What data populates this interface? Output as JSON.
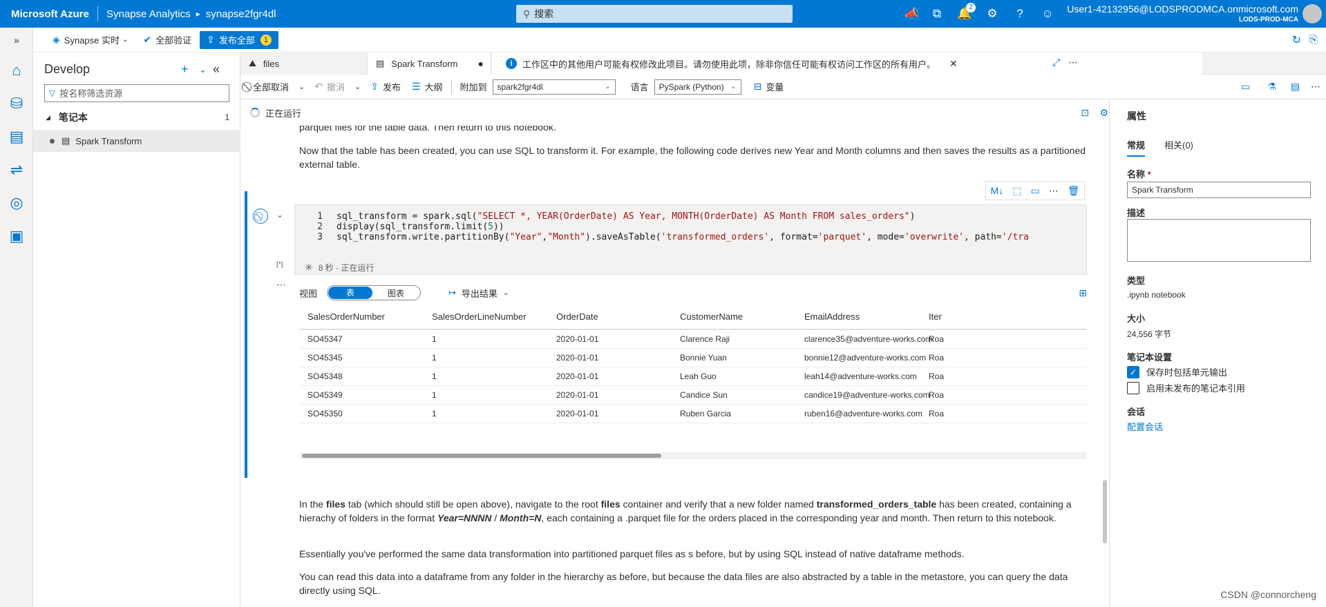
{
  "topbar": {
    "brand": "Microsoft Azure",
    "crumb1": "Synapse Analytics",
    "crumb2": "synapse2fgr4dl",
    "search_placeholder": "搜索",
    "notifications_count": "2",
    "user_name": "User1-42132956@LODSPRODMCA.onmicrosoft.com",
    "user_tenant": "LODS-PROD-MCA"
  },
  "commandbar": {
    "live_mode": "Synapse 实时",
    "validate_all": "全部验证",
    "publish_all": "发布全部",
    "publish_badge": "1"
  },
  "develop": {
    "title": "Develop",
    "filter_placeholder": "按名称筛选资源",
    "group_label": "笔记本",
    "group_count": "1",
    "item_label": "Spark Transform"
  },
  "tabs": {
    "files": "files",
    "spark": "Spark Transform",
    "modified_marker": "●",
    "warning": "工作区中的其他用户可能有权修改此项目。请勿使用此项，除非你信任可能有权访问工作区的所有用户。"
  },
  "nbtoolbar": {
    "cancel_all": "全部取消",
    "undo": "撤消",
    "publish": "发布",
    "outline": "大纲",
    "attach_label": "附加到",
    "attach_value": "spark2fgr4dl",
    "language_label": "语言",
    "language_value": "PySpark (Python)",
    "variables": "变量"
  },
  "status": {
    "running": "正在运行"
  },
  "content": {
    "para_top": "parquet files for the table data. Then return to this notebook.",
    "para_1": "Now that the table has been created, you can use SQL to transform it. For example, the following code derives new Year and Month columns and then saves the results as a partitioned external table.",
    "exec_count": "[*]",
    "exec_status": "8 秒 - 正在运行",
    "code": {
      "l1": "1",
      "l2": "2",
      "l3": "3",
      "c1_a": "sql_transform = spark.sql(",
      "c1_b": "\"SELECT *, YEAR(OrderDate) AS Year, MONTH(OrderDate) AS Month FROM sales_orders\"",
      "c1_c": ")",
      "c2_a": "display(sql_transform.limit(",
      "c2_b": "5",
      "c2_c": "))",
      "c3_a": "sql_transform.write.partitionBy(",
      "c3_b": "\"Year\"",
      "c3_c": ",",
      "c3_d": "\"Month\"",
      "c3_e": ").saveAsTable(",
      "c3_f": "'transformed_orders'",
      "c3_g": ", format=",
      "c3_h": "'parquet'",
      "c3_i": ", mode=",
      "c3_j": "'overwrite'",
      "c3_k": ", path=",
      "c3_l": "'/tra"
    },
    "view_label": "视图",
    "toggle_table": "表",
    "toggle_chart": "图表",
    "export_label": "导出结果",
    "table": {
      "headers": [
        "SalesOrderNumber",
        "SalesOrderLineNumber",
        "OrderDate",
        "CustomerName",
        "EmailAddress",
        "Iter"
      ],
      "rows": [
        [
          "SO45347",
          "1",
          "2020-01-01",
          "Clarence Raji",
          "clarence35@adventure-works.com",
          "Roa"
        ],
        [
          "SO45345",
          "1",
          "2020-01-01",
          "Bonnie Yuan",
          "bonnie12@adventure-works.com",
          "Roa"
        ],
        [
          "SO45348",
          "1",
          "2020-01-01",
          "Leah Guo",
          "leah14@adventure-works.com",
          "Roa"
        ],
        [
          "SO45349",
          "1",
          "2020-01-01",
          "Candice Sun",
          "candice19@adventure-works.com",
          "Roa"
        ],
        [
          "SO45350",
          "1",
          "2020-01-01",
          "Ruben Garcia",
          "ruben16@adventure-works.com",
          "Roa"
        ]
      ]
    },
    "para_2a": "In the ",
    "para_2b": "files",
    "para_2c": " tab (which should still be open above), navigate to the root ",
    "para_2d": "files",
    "para_2e": " container and verify that a new folder named ",
    "para_2f": "transformed_orders_table",
    "para_2g": " has been created, containing a hierachy of folders in the format ",
    "para_2h": "Year=NNNN",
    "para_2i": " / ",
    "para_2j": "Month=N",
    "para_2k": ", each containing a .parquet file for the orders placed in the corresponding year and month. Then return to this notebook.",
    "para_3": "Essentially you've performed the same data transformation into partitioned parquet files as s before, but by using SQL instead of native dataframe methods.",
    "para_4": "You can read this data into a dataframe from any folder in the hierarchy as before, but because the data files are also abstracted by a table in the metastore, you can query the data directly using SQL."
  },
  "properties": {
    "title": "属性",
    "tab_general": "常规",
    "tab_related": "相关(0)",
    "name_label": "名称",
    "required_marker": "*",
    "name_value": "Spark Transform",
    "desc_label": "描述",
    "type_label": "类型",
    "type_value": ".ipynb notebook",
    "size_label": "大小",
    "size_value": "24,556 字节",
    "settings_label": "笔记本设置",
    "opt1": "保存时包括单元输出",
    "opt2": "启用未发布的笔记本引用",
    "session_label": "会话",
    "session_link": "配置会话"
  },
  "watermark": "CSDN @connorcheng"
}
